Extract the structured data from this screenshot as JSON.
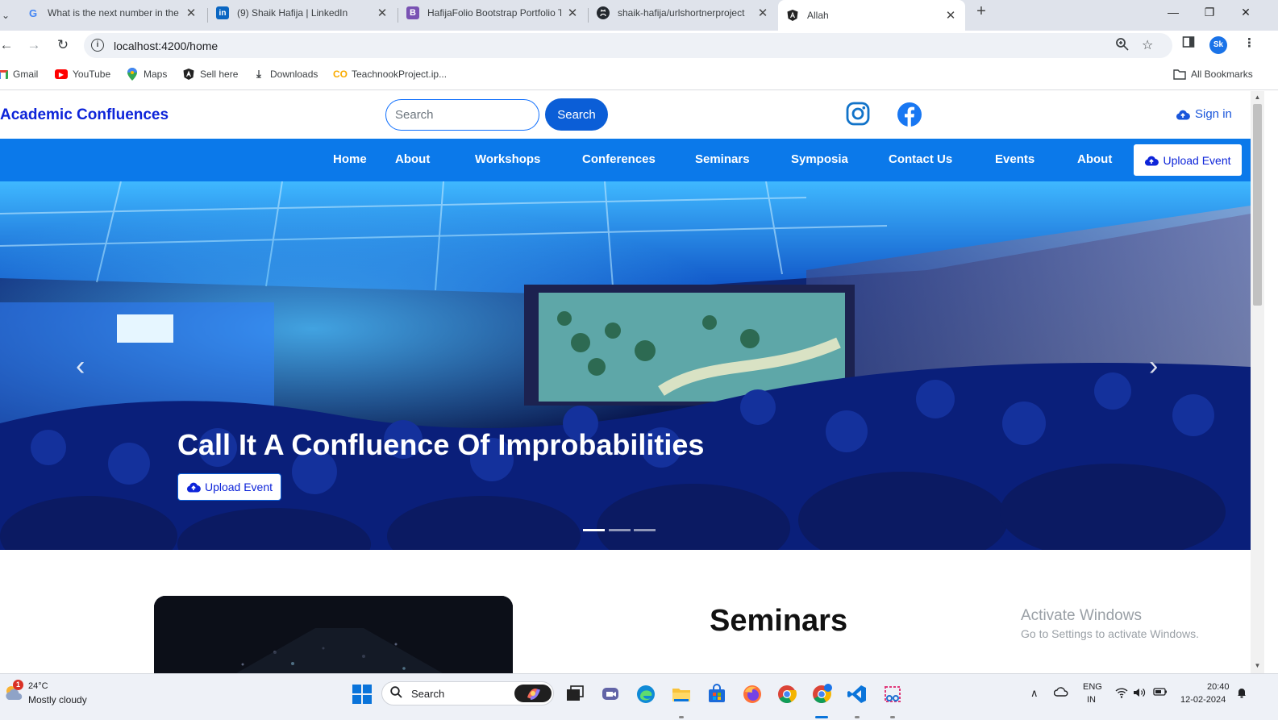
{
  "browser": {
    "tabs": [
      {
        "title": "What is the next number in the",
        "favicon": "google-icon"
      },
      {
        "title": "(9) Shaik Hafija | LinkedIn",
        "favicon": "linkedin-icon"
      },
      {
        "title": "HafijaFolio Bootstrap Portfolio T",
        "favicon": "bootstrap-icon"
      },
      {
        "title": "shaik-hafija/urlshortnerproject",
        "favicon": "github-icon"
      },
      {
        "title": "Allah",
        "favicon": "angular-icon"
      }
    ],
    "url": "localhost:4200/home",
    "profile_initials": "Sk",
    "bookmarks": [
      {
        "label": "Gmail",
        "icon": "gmail-icon"
      },
      {
        "label": "YouTube",
        "icon": "youtube-icon"
      },
      {
        "label": "Maps",
        "icon": "maps-icon"
      },
      {
        "label": "Sell here",
        "icon": "angular-icon"
      },
      {
        "label": "Downloads",
        "icon": "download-icon"
      },
      {
        "label": "TeachnookProject.ip...",
        "icon": "colab-icon"
      }
    ],
    "all_bookmarks": "All Bookmarks"
  },
  "site": {
    "brand": "Academic Confluences",
    "search_placeholder": "Search",
    "search_button": "Search",
    "signin": "Sign in",
    "nav": [
      "Home",
      "About",
      "Workshops",
      "Conferences",
      "Seminars",
      "Symposia",
      "Contact Us",
      "Events",
      "About"
    ],
    "nav_upload": "Upload Event",
    "hero": {
      "title": "Call It A Confluence Of Improbabilities",
      "button": "Upload Event",
      "slide_count": 3,
      "active_slide": 1
    },
    "section_title": "Seminars"
  },
  "windows": {
    "activate_title": "Activate Windows",
    "activate_sub": "Go to Settings to activate Windows."
  },
  "taskbar": {
    "weather_temp": "24°C",
    "weather_cond": "Mostly cloudy",
    "weather_badge": "1",
    "search": "Search",
    "lang_line1": "ENG",
    "lang_line2": "IN",
    "time": "20:40",
    "date": "12-02-2024"
  },
  "colors": {
    "nav_bar": "#0b79ea",
    "brand": "#0d24d9",
    "search_button": "#0b5ed7"
  }
}
